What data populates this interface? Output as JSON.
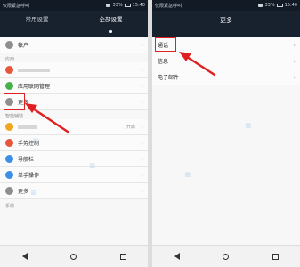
{
  "left": {
    "status": {
      "carrier": "仅限紧急呼叫",
      "battery": "33%",
      "time": "15:40"
    },
    "tabs": [
      {
        "label": "常用设置"
      },
      {
        "label": "全部设置"
      }
    ],
    "rows": {
      "account": "帐户",
      "app_manage": "应用联网管理",
      "more": "更多",
      "smart_assist_value": "开启",
      "gesture": "手势控制",
      "navbar": "导航栏",
      "one_hand": "单手操作",
      "more2": "更多"
    },
    "sections": {
      "apps": "应用",
      "smart": "智能辅助",
      "system": "系统"
    }
  },
  "right": {
    "status": {
      "carrier": "仅限紧急呼叫",
      "battery": "33%",
      "time": "15:40"
    },
    "title": "更多",
    "rows": {
      "phone": "通话",
      "messages": "信息",
      "email": "电子邮件"
    }
  },
  "colors": {
    "header": "#18222f",
    "highlight": "#e02020"
  }
}
